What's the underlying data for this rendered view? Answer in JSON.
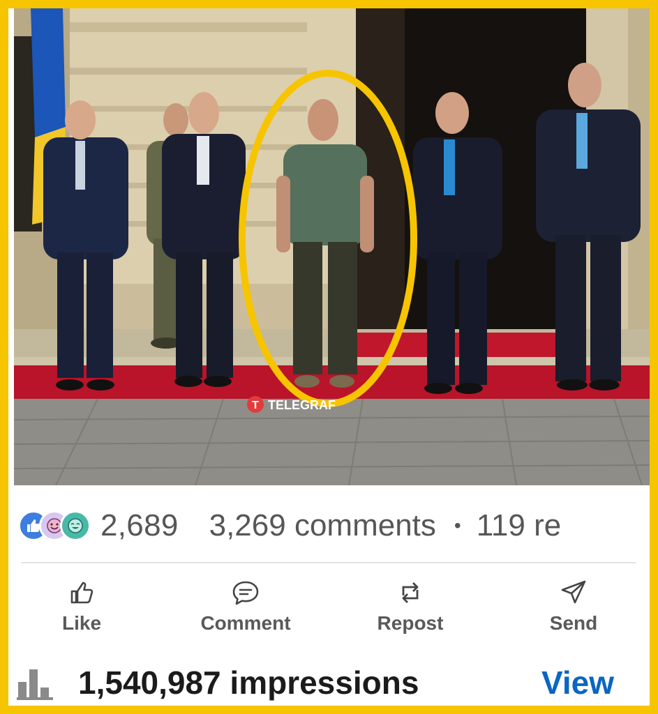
{
  "photo": {
    "watermark": "TELEGRAF",
    "highlight_color": "#f7c400"
  },
  "reactions": {
    "icons": [
      "like-icon",
      "funny-icon",
      "love-icon"
    ],
    "count": "2,689",
    "comments": "3,269 comments",
    "separator": "•",
    "reposts": "119 re"
  },
  "actions": {
    "like": "Like",
    "comment": "Comment",
    "repost": "Repost",
    "send": "Send"
  },
  "stats": {
    "impressions": "1,540,987 impressions",
    "view": "View"
  },
  "colors": {
    "frame": "#f7c400",
    "link": "#0a66c2",
    "text": "#565656"
  }
}
